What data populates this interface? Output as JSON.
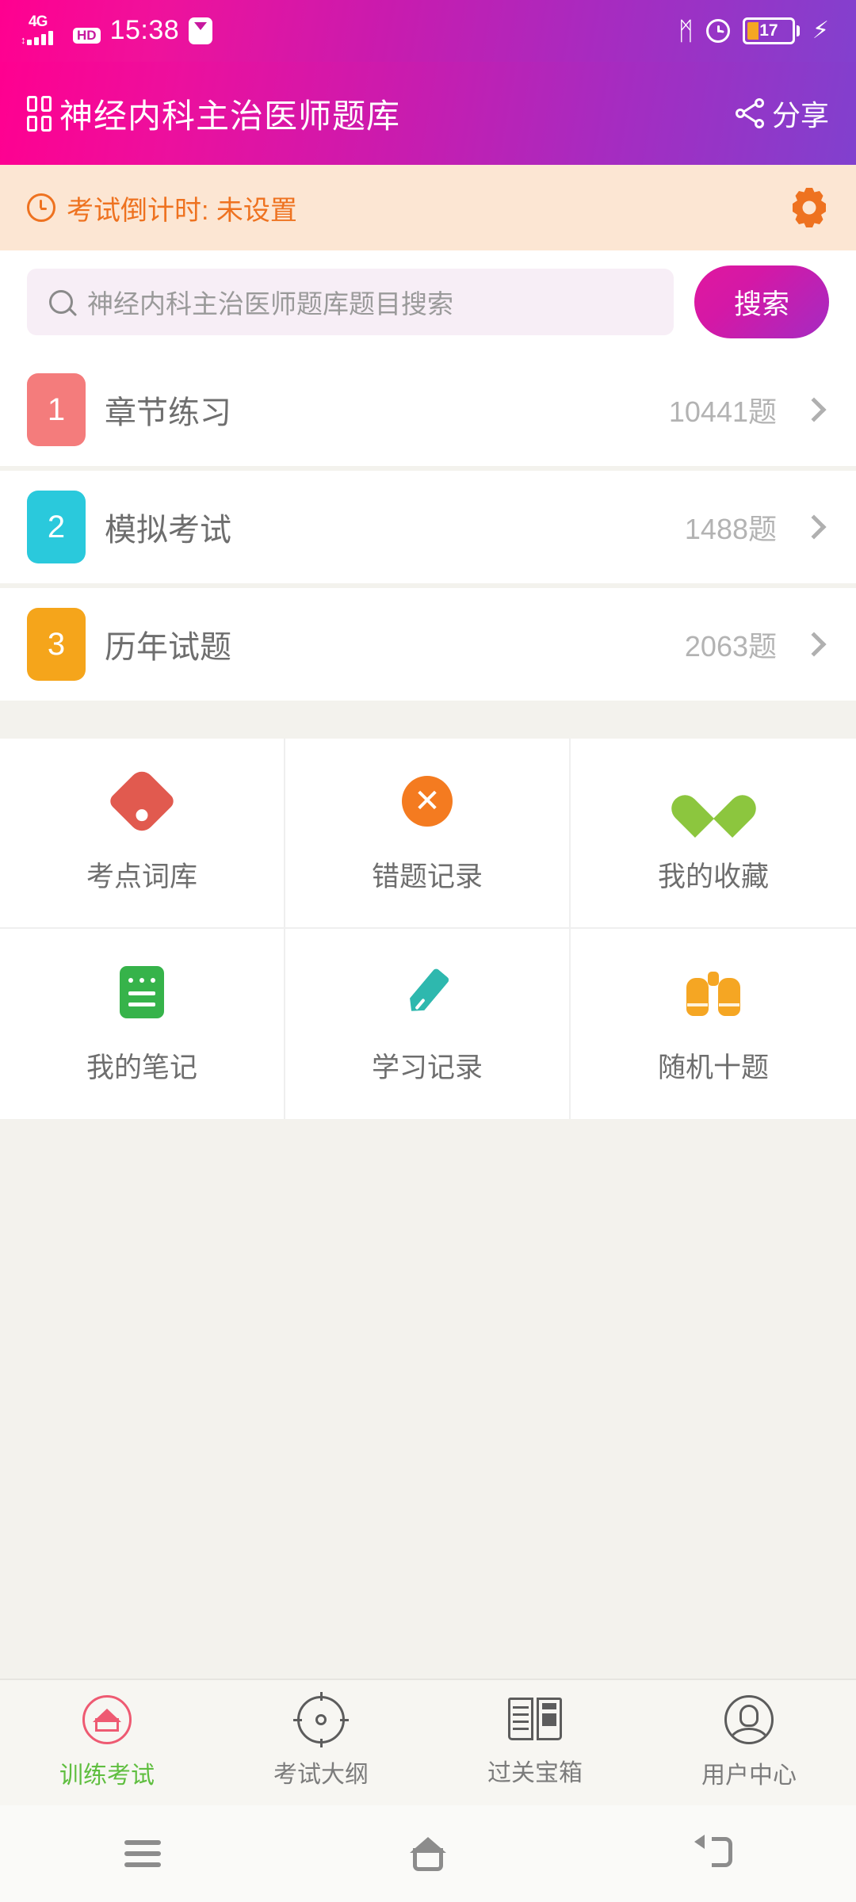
{
  "statusbar": {
    "network": "4G",
    "hd": "HD",
    "time": "15:38",
    "message_icon": "message-icon",
    "bluetooth_icon": "bluetooth-icon",
    "bluetooth_glyph": "ᛗ",
    "alarm_icon": "alarm-icon",
    "battery_level": "17",
    "charging_glyph": "⚡"
  },
  "appbar": {
    "title": "神经内科主治医师题库",
    "share_label": "分享",
    "gradient_from": "#FF0090",
    "gradient_to": "#8140CE"
  },
  "countdown": {
    "text": "考试倒计时: 未设置",
    "bg": "#FCE6D3",
    "fg": "#EE7220"
  },
  "search": {
    "placeholder": "神经内科主治医师题库题目搜索",
    "value": "",
    "button_label": "搜索"
  },
  "list": [
    {
      "num": "1",
      "label": "章节练习",
      "count": "10441题",
      "color": "#F47C7C"
    },
    {
      "num": "2",
      "label": "模拟考试",
      "count": "1488题",
      "color": "#2AC9DC"
    },
    {
      "num": "3",
      "label": "历年试题",
      "count": "2063题",
      "color": "#F5A51B"
    }
  ],
  "shortcuts": [
    {
      "label": "考点词库",
      "icon": "tag-icon",
      "color": "#E15A4F"
    },
    {
      "label": "错题记录",
      "icon": "close-circle-icon",
      "color": "#F47B20"
    },
    {
      "label": "我的收藏",
      "icon": "heart-icon",
      "color": "#8CC63E"
    },
    {
      "label": "我的笔记",
      "icon": "note-icon",
      "color": "#36B34A"
    },
    {
      "label": "学习记录",
      "icon": "pencil-icon",
      "color": "#2EB8AE"
    },
    {
      "label": "随机十题",
      "icon": "binoculars-icon",
      "color": "#F5A623"
    }
  ],
  "tabs": [
    {
      "label": "训练考试",
      "icon": "home-circle-icon",
      "active": true,
      "color": "#5FBE3F"
    },
    {
      "label": "考试大纲",
      "icon": "target-icon",
      "active": false,
      "color": "#7C7C7C"
    },
    {
      "label": "过关宝箱",
      "icon": "newspaper-icon",
      "active": false,
      "color": "#7C7C7C"
    },
    {
      "label": "用户中心",
      "icon": "user-circle-icon",
      "active": false,
      "color": "#7C7C7C"
    }
  ],
  "navbar": [
    {
      "icon": "menu-icon"
    },
    {
      "icon": "home-icon"
    },
    {
      "icon": "back-icon"
    }
  ]
}
